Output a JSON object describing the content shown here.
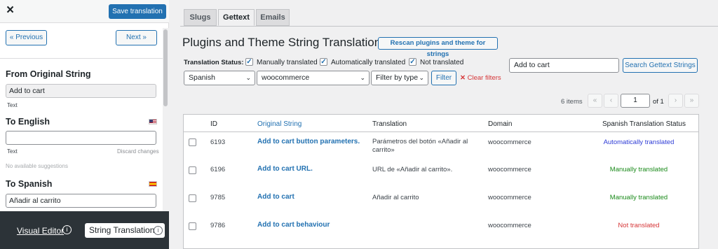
{
  "left_panel": {
    "close_icon": "×",
    "save_button": "Save translation",
    "prev_button": "« Previous",
    "next_button": "Next »",
    "from_original_title": "From Original String",
    "original_value": "Add to cart",
    "original_type": "Text",
    "to_english_title": "To English",
    "english_value": "",
    "english_type": "Text",
    "discard_changes": "Discard changes",
    "no_suggestions": "No available suggestions",
    "to_spanish_title": "To Spanish",
    "spanish_value": "Añadir al carrito",
    "flag_us_icon": "us-flag-icon",
    "flag_es_icon": "es-flag-icon"
  },
  "bottom_bar": {
    "visual_editor": "Visual Editor",
    "string_translation": "String Translation",
    "info_glyph": "i"
  },
  "tabs": [
    {
      "label": "Slugs",
      "active": false
    },
    {
      "label": "Gettext",
      "active": true
    },
    {
      "label": "Emails",
      "active": false
    }
  ],
  "main": {
    "title": "Plugins and Theme String Translation",
    "rescan_button": "Rescan plugins and theme for strings",
    "status_label": "Translation Status:",
    "checkboxes": [
      {
        "label": "Manually translated",
        "checked": true
      },
      {
        "label": "Automatically translated",
        "checked": true
      },
      {
        "label": "Not translated",
        "checked": true
      }
    ],
    "search_value": "Add to cart",
    "search_button": "Search Gettext Strings",
    "language_select": "Spanish",
    "domain_select": "woocommerce",
    "type_select": "Filter by type",
    "filter_button": "Filter",
    "clear_filters": "Clear filters",
    "items_count": "6 items",
    "current_page": "1",
    "page_of": "of 1",
    "pager": {
      "first": "«",
      "prev": "‹",
      "next": "›",
      "last": "»"
    }
  },
  "table": {
    "headers": [
      "ID",
      "Original String",
      "Translation",
      "Domain",
      "Spanish Translation Status"
    ],
    "rows": [
      {
        "id": "6193",
        "original": "Add to cart button parameters.",
        "translation": "Parámetros del botón «Añadir al carrito»",
        "domain": "woocommerce",
        "status": "Automatically translated",
        "status_color": "#2e3cd6"
      },
      {
        "id": "6196",
        "original": "Add to cart URL.",
        "translation": "URL de «Añadir al carrito».",
        "domain": "woocommerce",
        "status": "Manually translated",
        "status_color": "#1a8a1a"
      },
      {
        "id": "9785",
        "original": "Add to cart",
        "translation": "Añadir al carrito",
        "domain": "woocommerce",
        "status": "Manually translated",
        "status_color": "#1a8a1a"
      },
      {
        "id": "9786",
        "original": "Add to cart behaviour",
        "translation": "",
        "domain": "woocommerce",
        "status": "Not translated",
        "status_color": "#d63638"
      }
    ]
  },
  "colors": {
    "accent": "#2271b1",
    "danger": "#d63638",
    "sidebar_dark": "#2c3338"
  }
}
